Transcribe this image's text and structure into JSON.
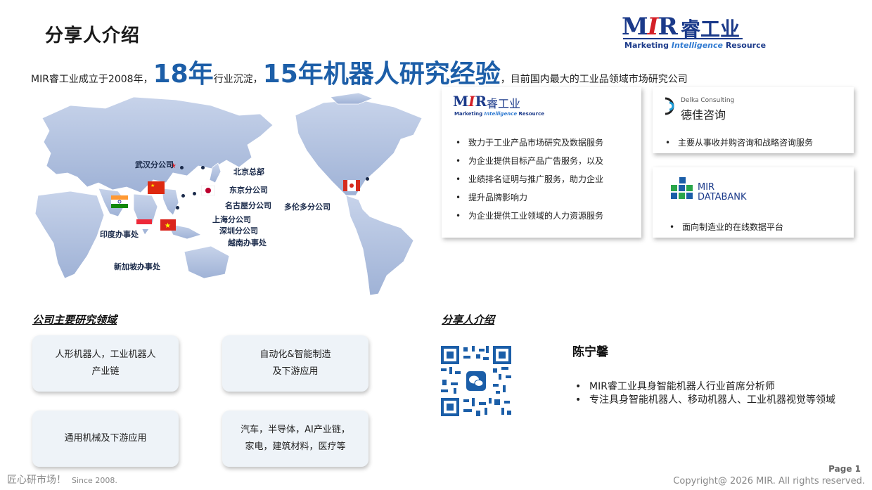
{
  "page_title": "分享人介绍",
  "brand": {
    "mir": "MIR",
    "name_cn": "睿工业",
    "tag_1": "Marketing",
    "tag_2": "Intelligence",
    "tag_3": "Resource",
    "primary_color": "#1b3a8a",
    "accent_color": "#d42027"
  },
  "intro": {
    "part1": "MIR睿工业成立于2008年，",
    "big1": "18年",
    "part2": "行业沉淀，",
    "big2": "15年机器人研究经验",
    "part3": "，目前国内最大的工业品领域市场研究公司",
    "highlight_color": "#1c5ea8"
  },
  "map": {
    "locations": [
      {
        "label": "武汉分公司",
        "flag": ""
      },
      {
        "label": "北京总部",
        "flag": ""
      },
      {
        "label": "东京分公司",
        "flag": "japan"
      },
      {
        "label": "名古屋分公司",
        "flag": ""
      },
      {
        "label": "上海分公司",
        "flag": ""
      },
      {
        "label": "深圳分公司",
        "flag": ""
      },
      {
        "label": "越南办事处",
        "flag": "vietnam"
      },
      {
        "label": "印度办事处",
        "flag": "india"
      },
      {
        "label": "新加坡办事处",
        "flag": "singapore"
      },
      {
        "label": "多伦多分公司",
        "flag": "canada"
      }
    ]
  },
  "cards": {
    "mir": {
      "logo_mir": "MIR",
      "logo_cn": "睿工业",
      "logo_tag_1": "Marketing",
      "logo_tag_2": "Intelligence",
      "logo_tag_3": "Resource",
      "bullets": [
        "致力于工业产品市场研究及数据服务",
        "为企业提供目标产品广告服务，以及",
        "业绩排名证明与推广服务，助力企业",
        "提升品牌影响力",
        "为企业提供工业领域的人力资源服务"
      ]
    },
    "delka": {
      "logo_en": "Delka Consulting",
      "logo_cn": "德佳咨询",
      "bullet": "主要从事收并购咨询和战略咨询服务"
    },
    "databank": {
      "logo_line1": "MIR",
      "logo_line2": "DATABANK",
      "bullet": "面向制造业的在线数据平台"
    }
  },
  "research": {
    "heading": "公司主要研究领域",
    "items": [
      {
        "line1": "人形机器人，工业机器人",
        "line2": "产业链"
      },
      {
        "line1": "自动化&智能制造",
        "line2": "及下游应用"
      },
      {
        "line1": "通用机械及下游应用",
        "line2": ""
      },
      {
        "line1": "汽车，半导体，AI产业链，",
        "line2": "家电，建筑材料，医疗等"
      }
    ]
  },
  "speaker": {
    "heading": "分享人介绍",
    "name": "陈宁馨",
    "bullets": [
      "MIR睿工业具身智能机器人行业首席分析师",
      "专注具身智能机器人、移动机器人、工业机器视觉等领域"
    ]
  },
  "footer": {
    "slogan": "匠心研市场！",
    "since": "Since 2008.",
    "page": "Page 1",
    "copyright": "Copyright@ 2026 MIR. All rights reserved."
  }
}
